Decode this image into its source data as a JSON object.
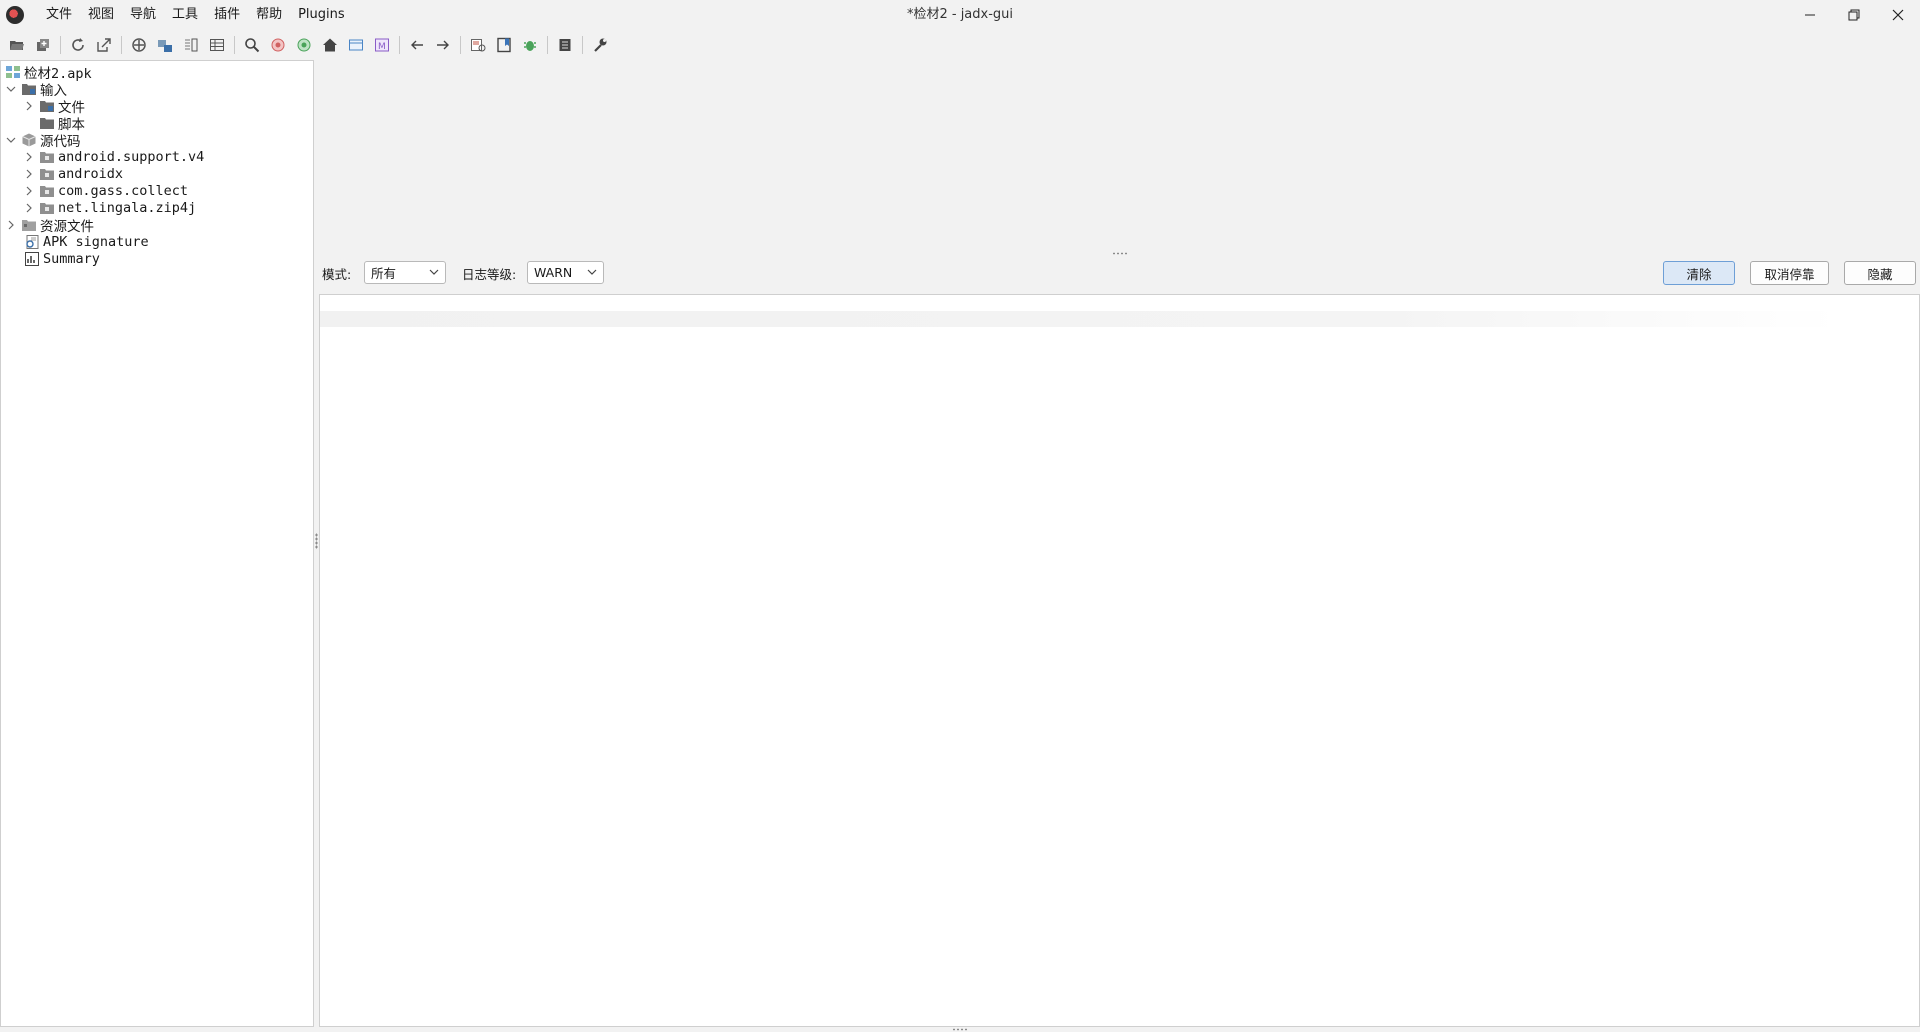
{
  "window": {
    "title": "*检材2 - jadx-gui"
  },
  "menu": {
    "items": [
      "文件",
      "视图",
      "导航",
      "工具",
      "插件",
      "帮助",
      "Plugins"
    ]
  },
  "toolbar": {
    "icons": [
      "open-file-icon",
      "add-files-icon",
      "reload-icon",
      "export-icon",
      "sync-icon",
      "flatten-packages-icon",
      "split-view-icon",
      "table-icon",
      "search-icon",
      "search-usage-icon",
      "search-text-icon",
      "home-icon",
      "class-browser-icon",
      "method-icon",
      "back-icon",
      "forward-icon",
      "decompile-all-icon",
      "bookmark-icon",
      "debug-icon",
      "log-icon",
      "settings-icon"
    ]
  },
  "tree": {
    "root": "检材2.apk",
    "input": "输入",
    "files": "文件",
    "scripts": "脚本",
    "source": "源代码",
    "packages": [
      "android.support.v4",
      "androidx",
      "com.gass.collect",
      "net.lingala.zip4j"
    ],
    "resources": "资源文件",
    "apk_signature": "APK signature",
    "summary": "Summary"
  },
  "log": {
    "mode_label": "模式:",
    "mode_value": "所有",
    "level_label": "日志等级:",
    "level_value": "WARN",
    "clear_label": "清除",
    "undock_label": "取消停靠",
    "hide_label": "隐藏"
  },
  "colors": {
    "background": "#f2f2f2",
    "panel": "#ffffff",
    "accent_button": "#dce8f6"
  }
}
